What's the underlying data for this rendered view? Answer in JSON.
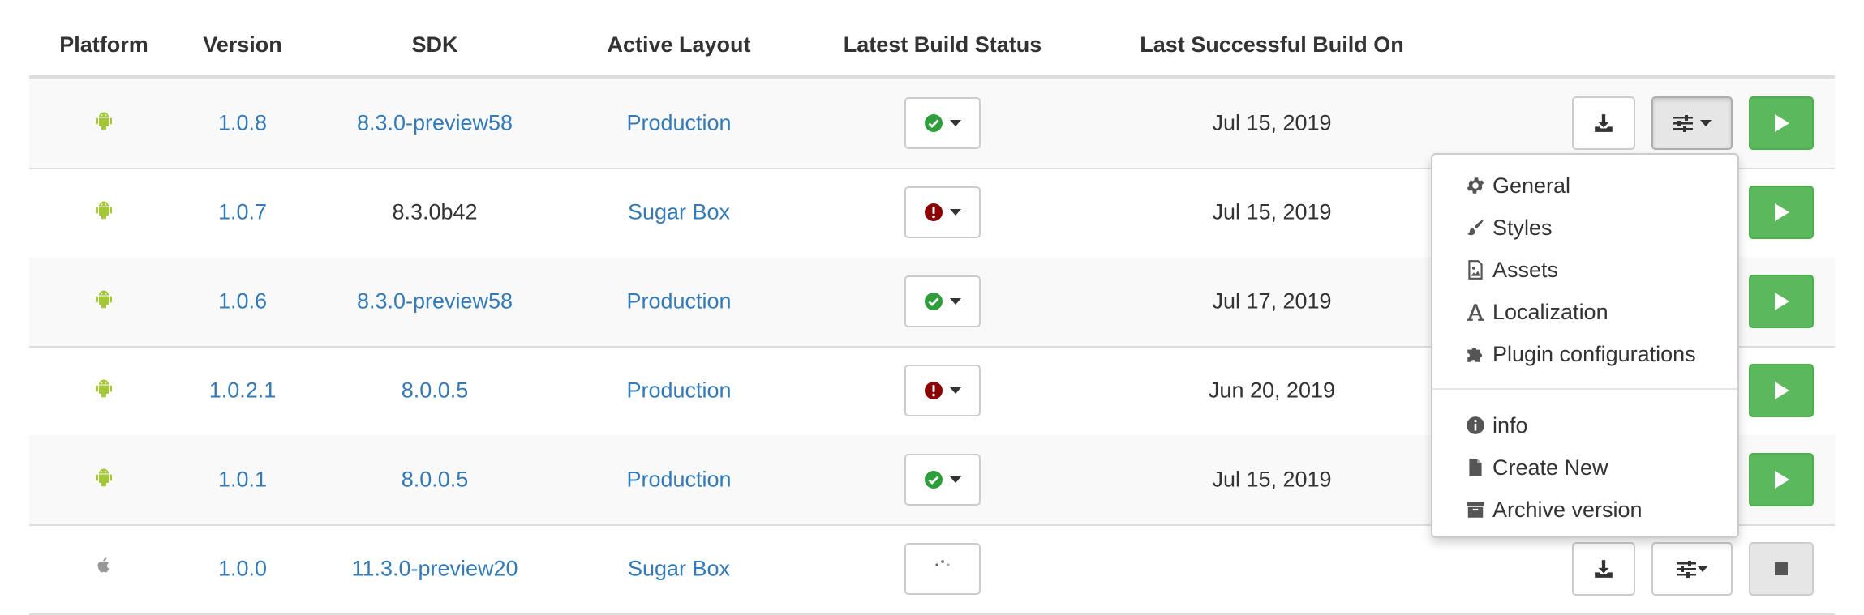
{
  "headers": {
    "platform": "Platform",
    "version": "Version",
    "sdk": "SDK",
    "active_layout": "Active Layout",
    "latest_build_status": "Latest Build Status",
    "last_successful_build_on": "Last Successful Build On"
  },
  "rows": [
    {
      "platform_icon": "android-icon",
      "version": "1.0.8",
      "sdk": "8.3.0-preview58",
      "sdk_link": true,
      "layout": "Production",
      "status": "success",
      "status_icon": "check-circle-icon",
      "date": "Jul 15, 2019"
    },
    {
      "platform_icon": "android-icon",
      "version": "1.0.7",
      "sdk": "8.3.0b42",
      "sdk_link": false,
      "layout": "Sugar Box",
      "status": "error",
      "status_icon": "exclamation-circle-icon",
      "date": "Jul 15, 2019"
    },
    {
      "platform_icon": "android-icon",
      "version": "1.0.6",
      "sdk": "8.3.0-preview58",
      "sdk_link": true,
      "layout": "Production",
      "status": "success",
      "status_icon": "check-circle-icon",
      "date": "Jul 17, 2019"
    },
    {
      "platform_icon": "android-icon",
      "version": "1.0.2.1",
      "sdk": "8.0.0.5",
      "sdk_link": true,
      "layout": "Production",
      "status": "error",
      "status_icon": "exclamation-circle-icon",
      "date": "Jun 20, 2019"
    },
    {
      "platform_icon": "android-icon",
      "version": "1.0.1",
      "sdk": "8.0.0.5",
      "sdk_link": true,
      "layout": "Production",
      "status": "success",
      "status_icon": "check-circle-icon",
      "date": "Jul 15, 2019"
    },
    {
      "platform_icon": "apple-icon",
      "version": "1.0.0",
      "sdk": "11.3.0-preview20",
      "sdk_link": true,
      "layout": "Sugar Box",
      "status": "pending",
      "status_icon": "spinner-icon",
      "date": ""
    }
  ],
  "actions": {
    "download_icon": "download-icon",
    "settings_icon": "sliders-icon",
    "run_icon": "play-icon"
  },
  "settings_menu": {
    "items": [
      {
        "label": "General",
        "icon": "gear-icon"
      },
      {
        "label": "Styles",
        "icon": "paint-brush-icon"
      },
      {
        "label": "Assets",
        "icon": "image-icon"
      },
      {
        "label": "Localization",
        "icon": "font-icon"
      },
      {
        "label": "Plugin configurations",
        "icon": "puzzle-icon"
      },
      {
        "label": "info",
        "icon": "info-circle-icon"
      },
      {
        "label": "Create New",
        "icon": "file-icon"
      },
      {
        "label": "Archive version",
        "icon": "archive-icon"
      }
    ]
  },
  "colors": {
    "link": "#337ab7",
    "android": "#a4c639",
    "success": "#2e9e3a",
    "error": "#8b0000",
    "run_button": "#5cb85c"
  }
}
